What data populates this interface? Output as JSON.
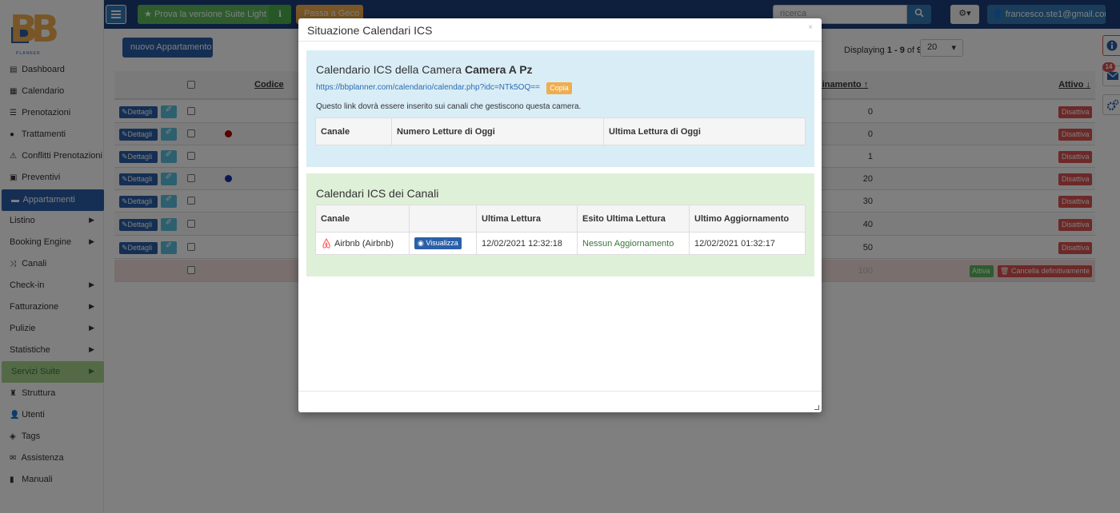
{
  "topbar": {
    "suite_label": "Prova la versione Suite Light",
    "geco_label": "Passa a Geco",
    "search_placeholder": "ricerca",
    "user_email": "francesco.ste1@gmail.com"
  },
  "sidebar": {
    "logo_sub": "PLANNER",
    "items": [
      {
        "label": "Dashboard",
        "icon": "dashboard-icon"
      },
      {
        "label": "Calendario",
        "icon": "calendar-icon"
      },
      {
        "label": "Prenotazioni",
        "icon": "list-icon"
      },
      {
        "label": "Trattamenti",
        "icon": "apple-icon"
      },
      {
        "label": "Conflitti Prenotazioni",
        "icon": "warning-icon"
      },
      {
        "label": "Preventivi",
        "icon": "document-icon"
      },
      {
        "label": "Appartamenti",
        "icon": "bed-icon"
      },
      {
        "label": "Listino",
        "icon": ""
      },
      {
        "label": "Booking Engine",
        "icon": ""
      },
      {
        "label": "Canali",
        "icon": "shuffle-icon"
      },
      {
        "label": "Check-in",
        "icon": ""
      },
      {
        "label": "Fatturazione",
        "icon": ""
      },
      {
        "label": "Pulizie",
        "icon": ""
      },
      {
        "label": "Statistiche",
        "icon": ""
      },
      {
        "label": "Servizi Suite",
        "icon": ""
      },
      {
        "label": "Struttura",
        "icon": "tower-icon"
      },
      {
        "label": "Utenti",
        "icon": "user-icon"
      },
      {
        "label": "Tags",
        "icon": "tags-icon"
      },
      {
        "label": "Assistenza",
        "icon": "envelope-icon"
      },
      {
        "label": "Manuali",
        "icon": "book-icon"
      }
    ]
  },
  "main": {
    "new_button": "nuovo Appartamento",
    "displaying_prefix": "Displaying ",
    "displaying_range": "1 - 9",
    "displaying_of": " of ",
    "displaying_total": "9",
    "per_page": "20",
    "col_codice": "Codice",
    "col_ordinamento": "dinamento",
    "col_attivo": "Attivo",
    "row_details_label": "Dettagli",
    "row_deactivate_label": "Disattiva",
    "rows": [
      "0",
      "0",
      "1",
      "20",
      "30",
      "40",
      "50"
    ],
    "last_row_value": "100",
    "activate_label": "Attiva",
    "delete_label": "Cancella definitivamente",
    "dot_colors": [
      "#b00000",
      "#1a2fa8"
    ],
    "notification_count": "14"
  },
  "modal": {
    "title": "Situazione Calendari ICS",
    "close_symbol": "×",
    "room_title_prefix": "Calendario ICS della Camera ",
    "room_name": "Camera A Pz",
    "ics_url": "https://bbplanner.com/calendario/calendar.php?idc=NTk5OQ==",
    "copy_label": "Copia",
    "note": "Questo link dovrà essere inserito sui canali che gestiscono questa camera.",
    "room_table_headers": [
      "Canale",
      "Numero Letture di Oggi",
      "Ultima Lettura di Oggi"
    ],
    "channels_title": "Calendari ICS dei Canali",
    "channels_table_headers": [
      "Canale",
      "",
      "Ultima Lettura",
      "Esito Ultima Lettura",
      "Ultimo Aggiornamento"
    ],
    "channels": [
      {
        "name": "Airbnb (Airbnb)",
        "view_label": "Visualizza",
        "last_read": "12/02/2021 12:32:18",
        "result": "Nessun Aggiornamento",
        "last_update": "12/02/2021 01:32:17"
      }
    ]
  }
}
